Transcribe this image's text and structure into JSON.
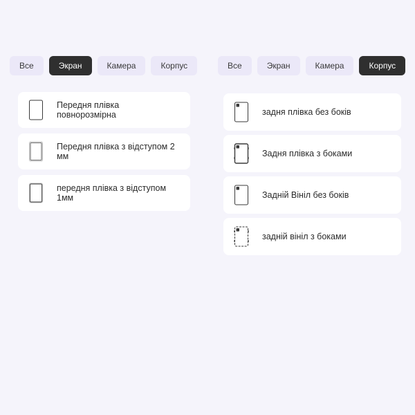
{
  "left_panel": {
    "tabs": [
      {
        "label": "Все",
        "active": false
      },
      {
        "label": "Экран",
        "active": true
      },
      {
        "label": "Камера",
        "active": false
      },
      {
        "label": "Корпус",
        "active": false
      }
    ],
    "items": [
      {
        "label": "Передня плівка повнорозмірна",
        "icon": "phone-front-full-icon"
      },
      {
        "label": "Передня плівка з відступом 2 мм",
        "icon": "phone-front-offset-icon"
      },
      {
        "label": "передня плівка з відступом 1мм",
        "icon": "phone-front-offset-icon"
      }
    ]
  },
  "right_panel": {
    "tabs": [
      {
        "label": "Все",
        "active": false
      },
      {
        "label": "Экран",
        "active": false
      },
      {
        "label": "Камера",
        "active": false
      },
      {
        "label": "Корпус",
        "active": true
      }
    ],
    "items": [
      {
        "label": "задня плівка без боків",
        "icon": "phone-back-icon"
      },
      {
        "label": "Задня плівка з боками",
        "icon": "phone-back-sides-icon"
      },
      {
        "label": "Задній Вініл без боків",
        "icon": "phone-back-icon"
      },
      {
        "label": "задній вініл з боками",
        "icon": "phone-back-sides-icon"
      }
    ]
  },
  "colors": {
    "background": "#f5f4fb",
    "tab_bg": "#ebe8f8",
    "tab_active_bg": "#2f2f2f",
    "card_bg": "#ffffff"
  }
}
